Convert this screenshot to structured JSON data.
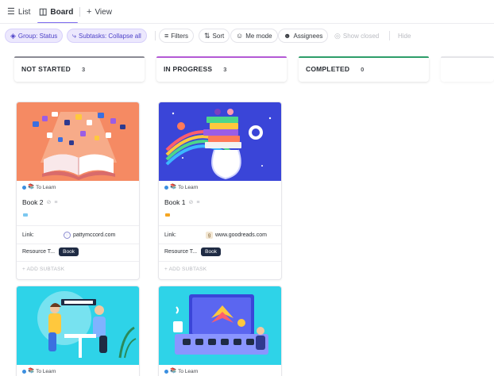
{
  "views": {
    "list": {
      "label": "List",
      "icon": "list-icon"
    },
    "board": {
      "label": "Board",
      "icon": "board-icon"
    },
    "add": {
      "label": "View",
      "icon": "plus-icon"
    }
  },
  "toolbar": {
    "group": "Group: Status",
    "subtasks": "Subtasks: Collapse all",
    "filters": "Filters",
    "sort": "Sort",
    "me_mode": "Me mode",
    "assignees": "Assignees",
    "show_closed": "Show closed",
    "hide": "Hide"
  },
  "columns": [
    {
      "name": "NOT STARTED",
      "count": "3",
      "color": "#8b8b94"
    },
    {
      "name": "IN PROGRESS",
      "count": "3",
      "color": "#b45ad6"
    },
    {
      "name": "COMPLETED",
      "count": "0",
      "color": "#2e9e6a"
    }
  ],
  "cards": [
    {
      "column": "NOT STARTED",
      "status": "To Learn",
      "title": "Book 2",
      "priority_color": "#7cc8f0",
      "link_label": "Link:",
      "link_url": "pattymccord.com",
      "resource_label": "Resource T...",
      "resource_tag": "Book",
      "add_subtask": "+ ADD SUBTASK",
      "cover_color": "#f58a63"
    },
    {
      "column": "IN PROGRESS",
      "status": "To Learn",
      "title": "Book 1",
      "priority_color": "#f5a623",
      "link_label": "Link:",
      "link_url": "www.goodreads.com",
      "resource_label": "Resource T...",
      "resource_tag": "Book",
      "add_subtask": "+ ADD SUBTASK",
      "cover_color": "#3a45d8"
    },
    {
      "column": "NOT STARTED",
      "status": "To Learn",
      "cover_color": "#2ed3e8"
    },
    {
      "column": "IN PROGRESS",
      "status": "To Learn",
      "cover_color": "#2ed3e8"
    }
  ]
}
